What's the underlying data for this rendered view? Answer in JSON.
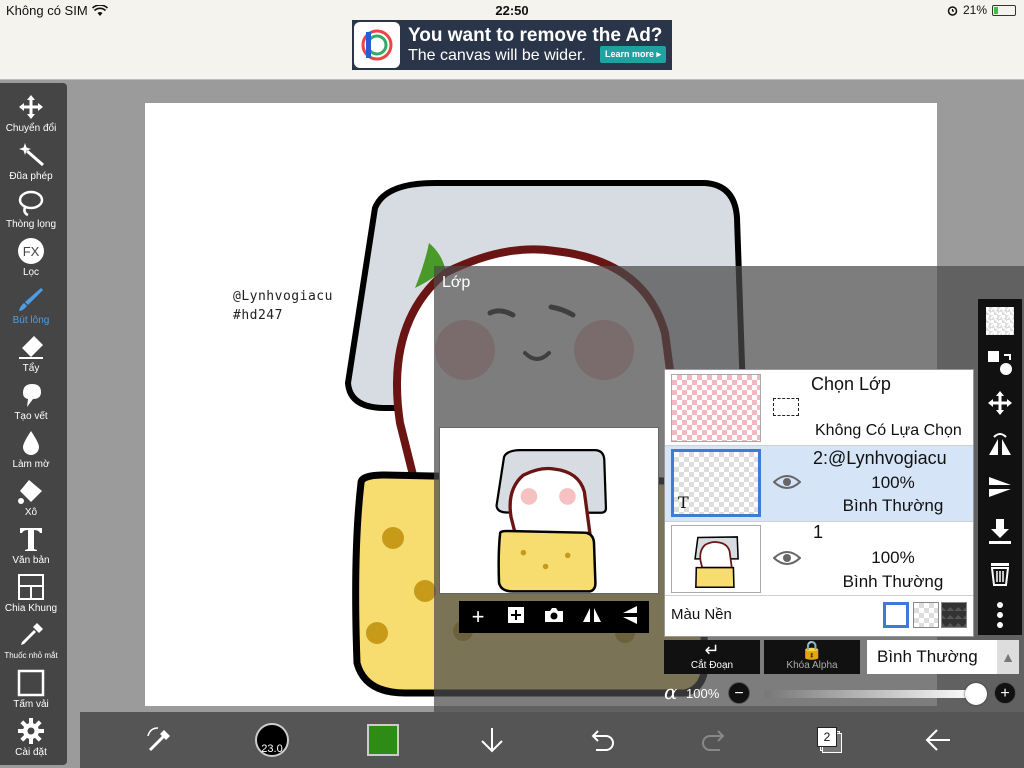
{
  "statusbar": {
    "carrier": "Không có SIM",
    "time": "22:50",
    "battery": "21%",
    "battery_level": 0.21
  },
  "ad": {
    "headline": "You want to remove the Ad?",
    "subline": "The canvas will be wider.",
    "button": "Learn more ▸"
  },
  "toolbar": {
    "items": [
      {
        "label": "Chuyển đổi",
        "icon": "move-icon"
      },
      {
        "label": "Đũa phép",
        "icon": "magic-wand-icon"
      },
      {
        "label": "Thòng lọng",
        "icon": "lasso-icon"
      },
      {
        "label": "Lọc",
        "icon": "fx-filter-icon"
      },
      {
        "label": "Bút lông",
        "icon": "brush-icon"
      },
      {
        "label": "Tẩy",
        "icon": "eraser-icon"
      },
      {
        "label": "Tạo vết",
        "icon": "smudge-icon"
      },
      {
        "label": "Làm mờ",
        "icon": "blur-drop-icon"
      },
      {
        "label": "Xô",
        "icon": "bucket-icon"
      },
      {
        "label": "Văn bản",
        "icon": "text-icon"
      },
      {
        "label": "Chia Khung",
        "icon": "frame-divider-icon"
      },
      {
        "label": "Thuốc nhỏ mắt",
        "icon": "eyedropper-icon"
      },
      {
        "label": "Tấm vải",
        "icon": "canvas-icon"
      },
      {
        "label": "Cài đặt",
        "icon": "gear-icon"
      }
    ],
    "active_index": 4,
    "active_color": "#4a9fe5"
  },
  "canvas": {
    "watermark_line1": "@Lynhvogiacu",
    "watermark_line2": "#hd247"
  },
  "layer_panel": {
    "title": "Lớp",
    "selection_layer": {
      "title": "Chọn Lớp",
      "status": "Không Có Lựa Chọn"
    },
    "layers": [
      {
        "name": "2:@Lynhvogiacu",
        "opacity": "100%",
        "blend": "Bình Thường",
        "selected": true,
        "type_badge": "T"
      },
      {
        "name": "1",
        "opacity": "100%",
        "blend": "Bình Thường",
        "selected": false
      }
    ],
    "background_label": "Màu Nền",
    "clipping_label": "Cắt Đoạn",
    "alpha_lock_label": "Khóa Alpha",
    "blend_mode": "Bình Thường",
    "alpha_symbol": "α",
    "alpha_value": "100%",
    "alpha_level": 1.0,
    "selected_color": "#d6e4f7"
  },
  "bottombar": {
    "brush_size": "23.0",
    "current_color": "#2e8b16",
    "layer_count": "2"
  }
}
